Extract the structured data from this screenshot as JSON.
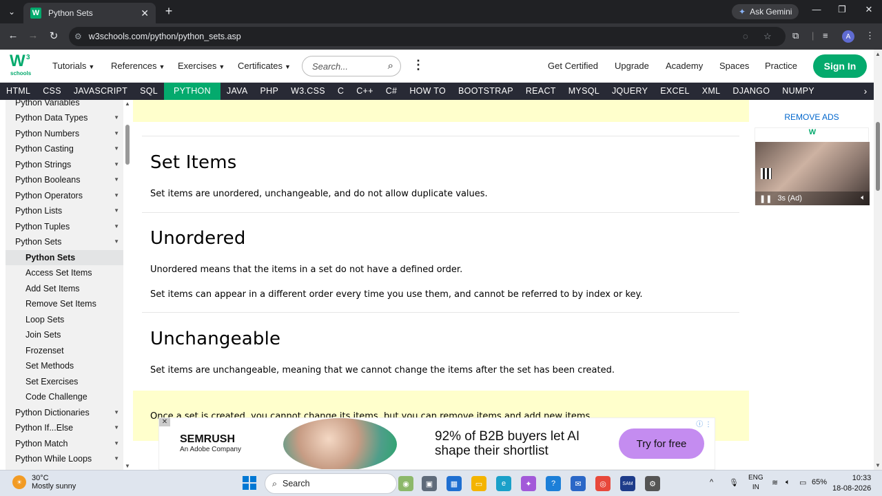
{
  "browser": {
    "tab_title": "Python Sets",
    "tab_favicon": "W",
    "ask_gemini": "Ask Gemini",
    "url": "w3schools.com/python/python_sets.asp",
    "profile_initial": "A"
  },
  "header": {
    "logo_text": "W",
    "logo_sup": "3",
    "logo_sub": "schools",
    "menus": [
      "Tutorials",
      "References",
      "Exercises",
      "Certificates"
    ],
    "search_placeholder": "Search...",
    "links": [
      "Get Certified",
      "Upgrade",
      "Academy",
      "Spaces",
      "Practice"
    ],
    "signin": "Sign In"
  },
  "topnav": [
    "HTML",
    "CSS",
    "JAVASCRIPT",
    "SQL",
    "PYTHON",
    "JAVA",
    "PHP",
    "W3.CSS",
    "C",
    "C++",
    "C#",
    "HOW TO",
    "BOOTSTRAP",
    "REACT",
    "MYSQL",
    "JQUERY",
    "EXCEL",
    "XML",
    "DJANGO",
    "NUMPY"
  ],
  "sidebar": {
    "items_top": [
      "Python Variables",
      "Python Data Types",
      "Python Numbers",
      "Python Casting",
      "Python Strings",
      "Python Booleans",
      "Python Operators",
      "Python Lists",
      "Python Tuples",
      "Python Sets"
    ],
    "sub_items": [
      "Python Sets",
      "Access Set Items",
      "Add Set Items",
      "Remove Set Items",
      "Loop Sets",
      "Join Sets",
      "Frozenset",
      "Set Methods",
      "Set Exercises",
      "Code Challenge"
    ],
    "items_bottom": [
      "Python Dictionaries",
      "Python If...Else",
      "Python Match",
      "Python While Loops"
    ]
  },
  "main": {
    "set_items_heading": "Set Items",
    "set_items_text": "Set items are unordered, unchangeable, and do not allow duplicate values.",
    "unordered_heading": "Unordered",
    "unordered_text1": "Unordered means that the items in a set do not have a defined order.",
    "unordered_text2": "Set items can appear in a different order every time you use them, and cannot be referred to by index or key.",
    "unchangeable_heading": "Unchangeable",
    "unchangeable_text": "Set items are unchangeable, meaning that we cannot change the items after the set has been created.",
    "note_text": "Once a set is created, you cannot change its items, but you can remove items and add new items."
  },
  "right_ad": {
    "remove_ads": "REMOVE ADS",
    "brand": "W",
    "countdown": "3s (Ad)"
  },
  "bottom_ad": {
    "brand": "SEMRUSH",
    "brand_sub": "An Adobe Company",
    "headline_line1": "92% of B2B buyers let AI",
    "headline_line2": "shape their shortlist",
    "cta": "Try for free"
  },
  "taskbar": {
    "temp": "30°C",
    "weather": "Mostly sunny",
    "search": "Search",
    "lang1": "ENG",
    "lang2": "IN",
    "battery": "65%",
    "time": "10:33",
    "date": "18-08-2026"
  },
  "colors": {
    "brand_green": "#04aa6d",
    "nav_dark": "#282a35",
    "note_yellow": "#ffffcc",
    "cta_purple": "#c48cf0"
  }
}
